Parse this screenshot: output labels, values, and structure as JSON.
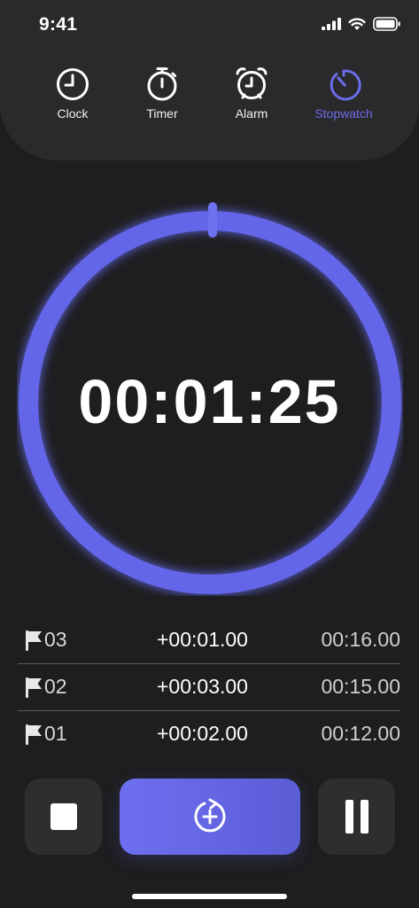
{
  "status_bar": {
    "time": "9:41",
    "icons": [
      "cellular-signal-icon",
      "wifi-icon",
      "battery-icon"
    ]
  },
  "tabs": [
    {
      "label": "Clock",
      "icon": "clock-icon",
      "active": false
    },
    {
      "label": "Timer",
      "icon": "timer-icon",
      "active": false
    },
    {
      "label": "Alarm",
      "icon": "alarm-icon",
      "active": false
    },
    {
      "label": "Stopwatch",
      "icon": "stopwatch-icon",
      "active": true
    }
  ],
  "stopwatch": {
    "time": "00:01:25"
  },
  "laps": [
    {
      "number": "03",
      "diff": "+00:01.00",
      "total": "00:16.00"
    },
    {
      "number": "02",
      "diff": "+00:03.00",
      "total": "00:15.00"
    },
    {
      "number": "01",
      "diff": "+00:02.00",
      "total": "00:12.00"
    }
  ],
  "controls": {
    "stop": "stop-icon",
    "lap": "lap-add-icon",
    "pause": "pause-icon"
  },
  "colors": {
    "accent": "#6b6de8",
    "background": "#1e1e20",
    "panel": "#2a2a2c",
    "button": "#2e2e30"
  }
}
